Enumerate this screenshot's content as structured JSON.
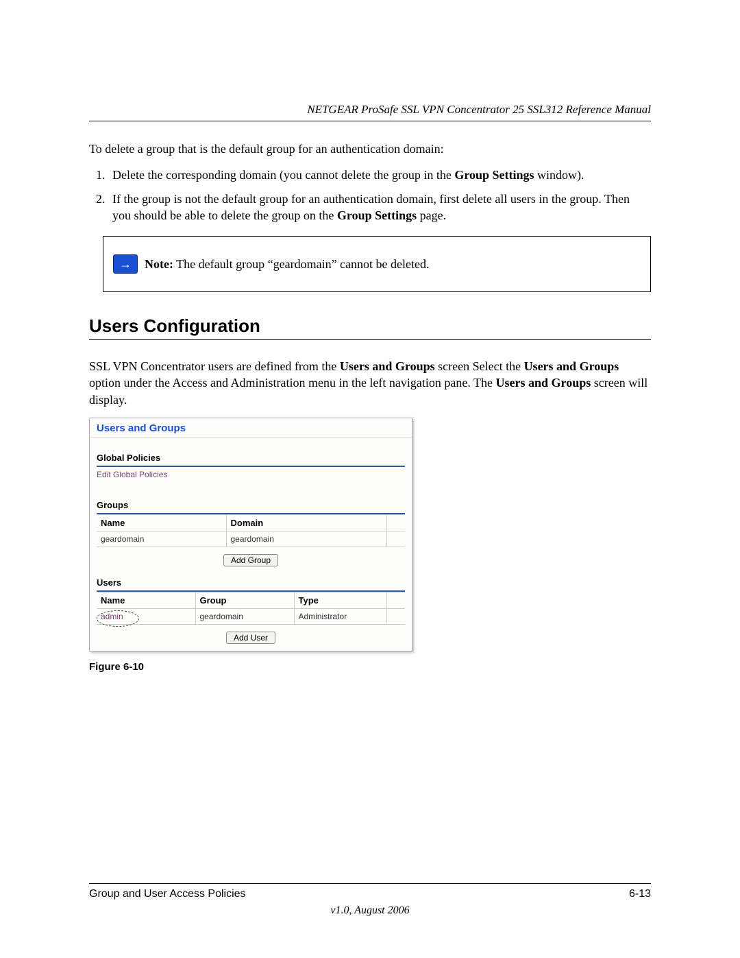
{
  "header": {
    "running_title": "NETGEAR ProSafe SSL VPN Concentrator 25 SSL312 Reference Manual"
  },
  "intro": "To delete a group that is the default group for an authentication domain:",
  "steps": {
    "s1_a": "Delete the corresponding domain (you cannot delete the group in the ",
    "s1_b": "Group Settings",
    "s1_c": " window).",
    "s2_a": "If the group is not the default group for an authentication domain, first delete all users in the group. Then you should be able to delete the group on the ",
    "s2_b": "Group Settings",
    "s2_c": " page."
  },
  "note": {
    "label": "Note:",
    "text": " The default group “geardomain” cannot be deleted."
  },
  "section_heading": "Users Configuration",
  "para": {
    "p1": "SSL VPN Concentrator users are defined from the ",
    "b1": "Users and Groups",
    "p2": " screen Select the ",
    "b2": "Users and Groups",
    "p3": " option under the Access and Administration menu in the left navigation pane. The ",
    "b3": "Users and Groups",
    "p4": " screen will display."
  },
  "screenshot": {
    "title": "Users and Groups",
    "global_policies": "Global Policies",
    "edit_global": "Edit Global Policies",
    "groups_hdr": "Groups",
    "groups_table": {
      "cols": {
        "name": "Name",
        "domain": "Domain"
      },
      "row": {
        "name": "geardomain",
        "domain": "geardomain"
      }
    },
    "add_group_btn": "Add Group",
    "users_hdr": "Users",
    "users_table": {
      "cols": {
        "name": "Name",
        "group": "Group",
        "type": "Type"
      },
      "row": {
        "name": "admin",
        "group": "geardomain",
        "type": "Administrator"
      }
    },
    "add_user_btn": "Add User"
  },
  "figure_caption": "Figure 6-10",
  "footer": {
    "left": "Group and User Access Policies",
    "right": "6-13",
    "version": "v1.0, August 2006"
  }
}
